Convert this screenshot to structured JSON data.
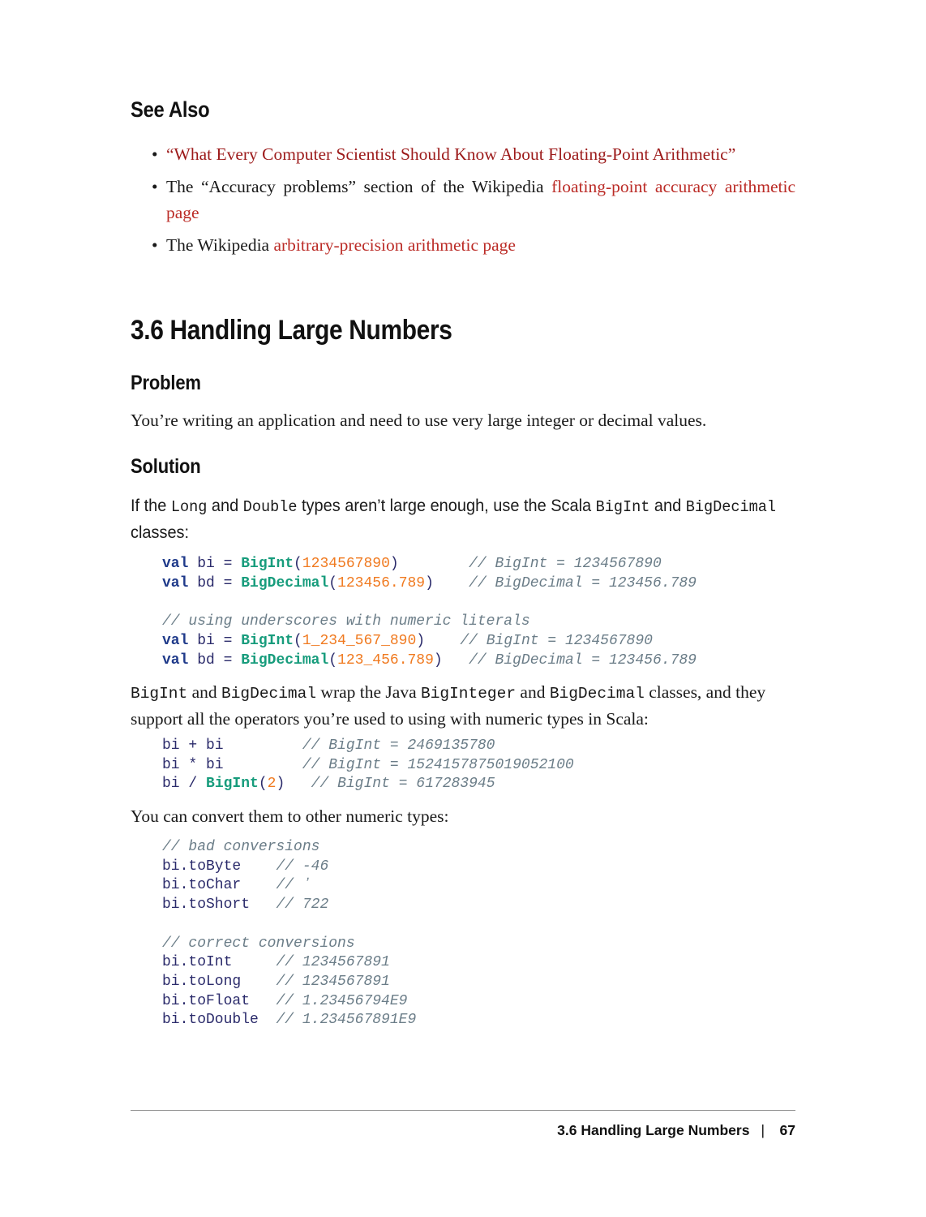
{
  "document": {
    "see_also_heading": "See Also",
    "see_also_items": [
      {
        "prefix": "",
        "link": "“What Every Computer Scientist Should Know About Floating-Point Arithmetic”",
        "suffix": "",
        "link_color": "#9c1a1a"
      },
      {
        "prefix": "The “Accuracy problems” section of the Wikipedia ",
        "link": "floating-point accuracy arithmetic page",
        "suffix": "",
        "link_color": "#bb2b26"
      },
      {
        "prefix": "The Wikipedia ",
        "link": "arbitrary-precision arithmetic page",
        "suffix": "",
        "link_color": "#bb2b26"
      }
    ],
    "recipe_heading": "3.6 Handling Large Numbers",
    "problem_heading": "Problem",
    "problem_text": "You’re writing an application and need to use very large integer or decimal values.",
    "solution_heading": "Solution",
    "solution_intro": {
      "part1": "If the ",
      "code1": "Long",
      "part2": " and ",
      "code2": "Double",
      "part3": " types aren’t large enough, use the Scala ",
      "code3": "BigInt",
      "part4": " and ",
      "code4": "BigDeci",
      "part5": "mal",
      "part6": " classes:"
    },
    "wrap_paragraph": {
      "code1": "BigInt",
      "part1": " and ",
      "code2": "BigDecimal",
      "part2": " wrap the Java ",
      "code3": "BigInteger",
      "part3": " and ",
      "code4": "BigDecimal",
      "part4": " classes, and they support all the operators you’re used to using with numeric types in Scala:"
    },
    "convert_paragraph": "You can convert them to other numeric types:",
    "footer": {
      "title": "3.6 Handling Large Numbers",
      "separator": "|",
      "page_number": "67"
    }
  },
  "code_blocks": {
    "block1": [
      [
        {
          "t": "val",
          "c": "kw"
        },
        {
          "t": " ",
          "c": "pun"
        },
        {
          "t": "bi",
          "c": "var"
        },
        {
          "t": " = ",
          "c": "pun"
        },
        {
          "t": "BigInt",
          "c": "typ"
        },
        {
          "t": "(",
          "c": "pun"
        },
        {
          "t": "1234567890",
          "c": "num"
        },
        {
          "t": ")",
          "c": "pun"
        },
        {
          "t": "        ",
          "c": "pun"
        },
        {
          "t": "// BigInt = 1234567890",
          "c": "cmt"
        }
      ],
      [
        {
          "t": "val",
          "c": "kw"
        },
        {
          "t": " ",
          "c": "pun"
        },
        {
          "t": "bd",
          "c": "var"
        },
        {
          "t": " = ",
          "c": "pun"
        },
        {
          "t": "BigDecimal",
          "c": "typ"
        },
        {
          "t": "(",
          "c": "pun"
        },
        {
          "t": "123456.789",
          "c": "num"
        },
        {
          "t": ")",
          "c": "pun"
        },
        {
          "t": "    ",
          "c": "pun"
        },
        {
          "t": "// BigDecimal = 123456.789",
          "c": "cmt"
        }
      ],
      [],
      [
        {
          "t": "// using underscores with numeric literals",
          "c": "cmt"
        }
      ],
      [
        {
          "t": "val",
          "c": "kw"
        },
        {
          "t": " ",
          "c": "pun"
        },
        {
          "t": "bi",
          "c": "var"
        },
        {
          "t": " = ",
          "c": "pun"
        },
        {
          "t": "BigInt",
          "c": "typ"
        },
        {
          "t": "(",
          "c": "pun"
        },
        {
          "t": "1_234_567_890",
          "c": "num"
        },
        {
          "t": ")",
          "c": "pun"
        },
        {
          "t": "    ",
          "c": "pun"
        },
        {
          "t": "// BigInt = 1234567890",
          "c": "cmt"
        }
      ],
      [
        {
          "t": "val",
          "c": "kw"
        },
        {
          "t": " ",
          "c": "pun"
        },
        {
          "t": "bd",
          "c": "var"
        },
        {
          "t": " = ",
          "c": "pun"
        },
        {
          "t": "BigDecimal",
          "c": "typ"
        },
        {
          "t": "(",
          "c": "pun"
        },
        {
          "t": "123_456.789",
          "c": "num"
        },
        {
          "t": ")",
          "c": "pun"
        },
        {
          "t": "   ",
          "c": "pun"
        },
        {
          "t": "// BigDecimal = 123456.789",
          "c": "cmt"
        }
      ]
    ],
    "block2": [
      [
        {
          "t": "bi + bi",
          "c": "var"
        },
        {
          "t": "         ",
          "c": "pun"
        },
        {
          "t": "// BigInt = 2469135780",
          "c": "cmt"
        }
      ],
      [
        {
          "t": "bi * bi",
          "c": "var"
        },
        {
          "t": "         ",
          "c": "pun"
        },
        {
          "t": "// BigInt = 1524157875019052100",
          "c": "cmt"
        }
      ],
      [
        {
          "t": "bi / ",
          "c": "var"
        },
        {
          "t": "BigInt",
          "c": "typ"
        },
        {
          "t": "(",
          "c": "pun"
        },
        {
          "t": "2",
          "c": "num"
        },
        {
          "t": ")",
          "c": "pun"
        },
        {
          "t": "   ",
          "c": "pun"
        },
        {
          "t": "// BigInt = 617283945",
          "c": "cmt"
        }
      ]
    ],
    "block3": [
      [
        {
          "t": "// bad conversions",
          "c": "cmt"
        }
      ],
      [
        {
          "t": "bi.toByte",
          "c": "var"
        },
        {
          "t": "    ",
          "c": "pun"
        },
        {
          "t": "// -46",
          "c": "cmt"
        }
      ],
      [
        {
          "t": "bi.toChar",
          "c": "var"
        },
        {
          "t": "    ",
          "c": "pun"
        },
        {
          "t": "// ʼ",
          "c": "cmt"
        }
      ],
      [
        {
          "t": "bi.toShort",
          "c": "var"
        },
        {
          "t": "   ",
          "c": "pun"
        },
        {
          "t": "// 722",
          "c": "cmt"
        }
      ],
      [],
      [
        {
          "t": "// correct conversions",
          "c": "cmt"
        }
      ],
      [
        {
          "t": "bi.toInt",
          "c": "var"
        },
        {
          "t": "     ",
          "c": "pun"
        },
        {
          "t": "// 1234567891",
          "c": "cmt"
        }
      ],
      [
        {
          "t": "bi.toLong",
          "c": "var"
        },
        {
          "t": "    ",
          "c": "pun"
        },
        {
          "t": "// 1234567891",
          "c": "cmt"
        }
      ],
      [
        {
          "t": "bi.toFloat",
          "c": "var"
        },
        {
          "t": "   ",
          "c": "pun"
        },
        {
          "t": "// 1.23456794E9",
          "c": "cmt"
        }
      ],
      [
        {
          "t": "bi.toDouble",
          "c": "var"
        },
        {
          "t": "  ",
          "c": "pun"
        },
        {
          "t": "// 1.234567891E9",
          "c": "cmt"
        }
      ]
    ]
  },
  "colors": {
    "keyword": "#1f3a8a",
    "type": "#179c7c",
    "number": "#f07a20",
    "comment": "#6b7d88",
    "variable": "#2b2b6b",
    "link_dark_red": "#9c1a1a",
    "link_red": "#bb2b26",
    "text": "#1a1a1a",
    "rule": "#8c8c8c"
  }
}
